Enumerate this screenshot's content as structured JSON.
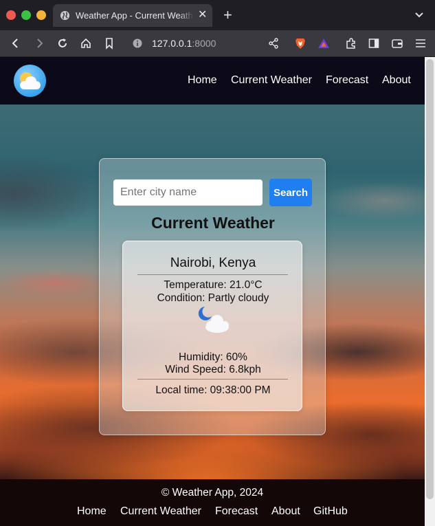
{
  "browser": {
    "tab_title": "Weather App - Current Weather",
    "tab_close_glyph": "✕",
    "new_tab_glyph": "+",
    "url_host": "127.0.0.1",
    "url_port": ":8000",
    "colors": {
      "chrome_dark": "#1f1e24",
      "toolbar": "#3a3940"
    }
  },
  "navbar": {
    "logo_icon": "partly-sunny-icon",
    "links": [
      "Home",
      "Current Weather",
      "Forecast",
      "About"
    ]
  },
  "search": {
    "placeholder": "Enter city name",
    "value": "",
    "button_label": "Search"
  },
  "weather": {
    "heading": "Current Weather",
    "location": "Nairobi, Kenya",
    "temperature": "Temperature: 21.0°C",
    "condition": "Condition: Partly cloudy",
    "condition_icon": "partly-cloudy-night-icon",
    "humidity": "Humidity: 60%",
    "wind": "Wind Speed: 6.8kph",
    "local_time": "Local time: 09:38:00 PM"
  },
  "footer": {
    "copyright": "© Weather App, 2024",
    "links": [
      "Home",
      "Current Weather",
      "Forecast",
      "About",
      "GitHub"
    ]
  },
  "colors": {
    "navbar_bg": "#0c0a18",
    "footer_bg": "#140708",
    "search_button": "#1f7ef0"
  }
}
